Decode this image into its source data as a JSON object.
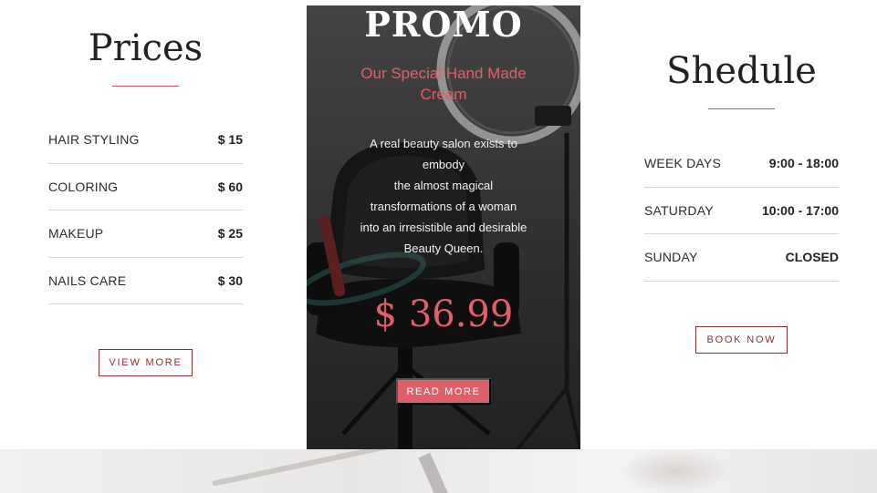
{
  "prices": {
    "title": "Prices",
    "items": [
      {
        "label": "HAIR STYLING",
        "value": "$ 15"
      },
      {
        "label": "COLORING",
        "value": "$ 60"
      },
      {
        "label": "MAKEUP",
        "value": "$ 25"
      },
      {
        "label": "NAILS CARE",
        "value": "$ 30"
      }
    ],
    "button_label": "VIEW MORE"
  },
  "promo": {
    "title": "PROMO",
    "subtitle": "Our Special Hand Made Cream",
    "description_lines": [
      "A real beauty salon exists to",
      "embody",
      "the almost magical",
      "transformations of a woman",
      "into an irresistible and desirable",
      "Beauty Queen."
    ],
    "price": "$ 36.99",
    "button_label": "READ MORE"
  },
  "schedule": {
    "title": "Shedule",
    "items": [
      {
        "label": "WEEK DAYS",
        "value": "9:00 - 18:00"
      },
      {
        "label": "SATURDAY",
        "value": "10:00 - 17:00"
      },
      {
        "label": "SUNDAY",
        "value": "CLOSED"
      }
    ],
    "button_label": "BOOK NOW"
  },
  "colors": {
    "accent": "#e0606a",
    "button_border": "#8a2f35",
    "text": "#222222"
  }
}
